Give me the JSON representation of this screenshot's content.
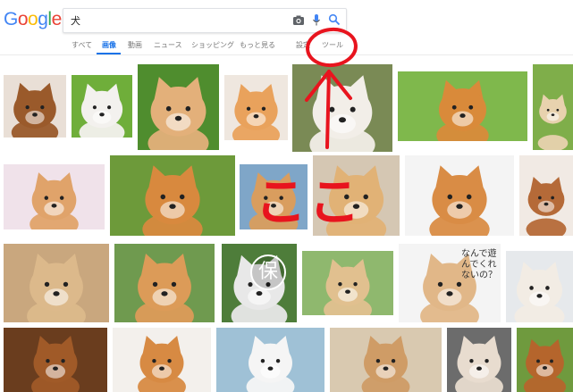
{
  "logo": {
    "letters": [
      "G",
      "o",
      "o",
      "g",
      "l",
      "e"
    ],
    "colors": [
      "#4285F4",
      "#EA4335",
      "#FBBC05",
      "#4285F4",
      "#34A853",
      "#EA4335"
    ]
  },
  "search": {
    "query": "犬"
  },
  "nav": {
    "items": [
      "すべて",
      "画像",
      "動画",
      "ニュース",
      "ショッピング",
      "もっと見る",
      "設定",
      "ツール"
    ],
    "active_index": 1
  },
  "annotation": {
    "text": "ここ",
    "color": "#e8141e"
  },
  "colors": {
    "accent": "#1a73e8"
  },
  "images": [
    {
      "name": "dachshund-puppy",
      "bg": "#e9dfd6",
      "fur": "#9a5a2b"
    },
    {
      "name": "papillon-white",
      "bg": "#6fae3a",
      "fur": "#f3f1ee"
    },
    {
      "name": "shiba-smiling",
      "bg": "#4f8d2e",
      "fur": "#e3b07a"
    },
    {
      "name": "pomeranian-orange",
      "bg": "#efe7df",
      "fur": "#e9a25c"
    },
    {
      "name": "pomeranian-cream",
      "bg": "#7a8a55",
      "fur": "#f2eee8"
    },
    {
      "name": "shiba-standing-field",
      "bg": "#7fb84c",
      "fur": "#d98a3a"
    },
    {
      "name": "partial-dog-green",
      "bg": "#7fae4a",
      "fur": "#e8d2ae"
    },
    {
      "name": "chihuahua-pink-blanket",
      "bg": "#f0e2ea",
      "fur": "#e0a36a"
    },
    {
      "name": "shiba-lying-grass",
      "bg": "#6d9a3a",
      "fur": "#d8893e"
    },
    {
      "name": "chihuahua-smiling",
      "bg": "#7fa6c8",
      "fur": "#d99d5e"
    },
    {
      "name": "lab-puppy",
      "bg": "#d5c7b3",
      "fur": "#e1b276"
    },
    {
      "name": "shiba-white-bg",
      "bg": "#f4f4f4",
      "fur": "#d98c45"
    },
    {
      "name": "cavalier-puppy",
      "bg": "#f1eae4",
      "fur": "#b56a38"
    },
    {
      "name": "puppy-closeup",
      "bg": "#c9a77e",
      "fur": "#dcb98b"
    },
    {
      "name": "shiba-portrait",
      "bg": "#6f9a4f",
      "fur": "#dc9b58"
    },
    {
      "name": "dog-protection-logo",
      "bg": "#4e7d3a",
      "fur": "#e8e8e8",
      "label": "保"
    },
    {
      "name": "shiba-puppy-walk",
      "bg": "#8fb86e",
      "fur": "#e1c08f"
    },
    {
      "name": "dog-text-card",
      "bg": "#f4f4f4",
      "fur": "#e1b788",
      "caption": "なんで遊んでくれないの？"
    },
    {
      "name": "dog-lying-partial",
      "bg": "#e6e9ec",
      "fur": "#f2ece4"
    },
    {
      "name": "brown-dog-closeup",
      "bg": "#6a3d1e",
      "fur": "#a05a28"
    },
    {
      "name": "shiba-sitting",
      "bg": "#f3f0ec",
      "fur": "#d78a43"
    },
    {
      "name": "white-dog-beach",
      "bg": "#9fc1d6",
      "fur": "#f5f5f5"
    },
    {
      "name": "three-puppies",
      "bg": "#d9c9b0",
      "fur": "#cf9c66"
    },
    {
      "name": "chihuahua-face",
      "bg": "#6c6c6c",
      "fur": "#e8dccf"
    },
    {
      "name": "dog-running-grass",
      "bg": "#6f9a3e",
      "fur": "#b5652c"
    }
  ]
}
